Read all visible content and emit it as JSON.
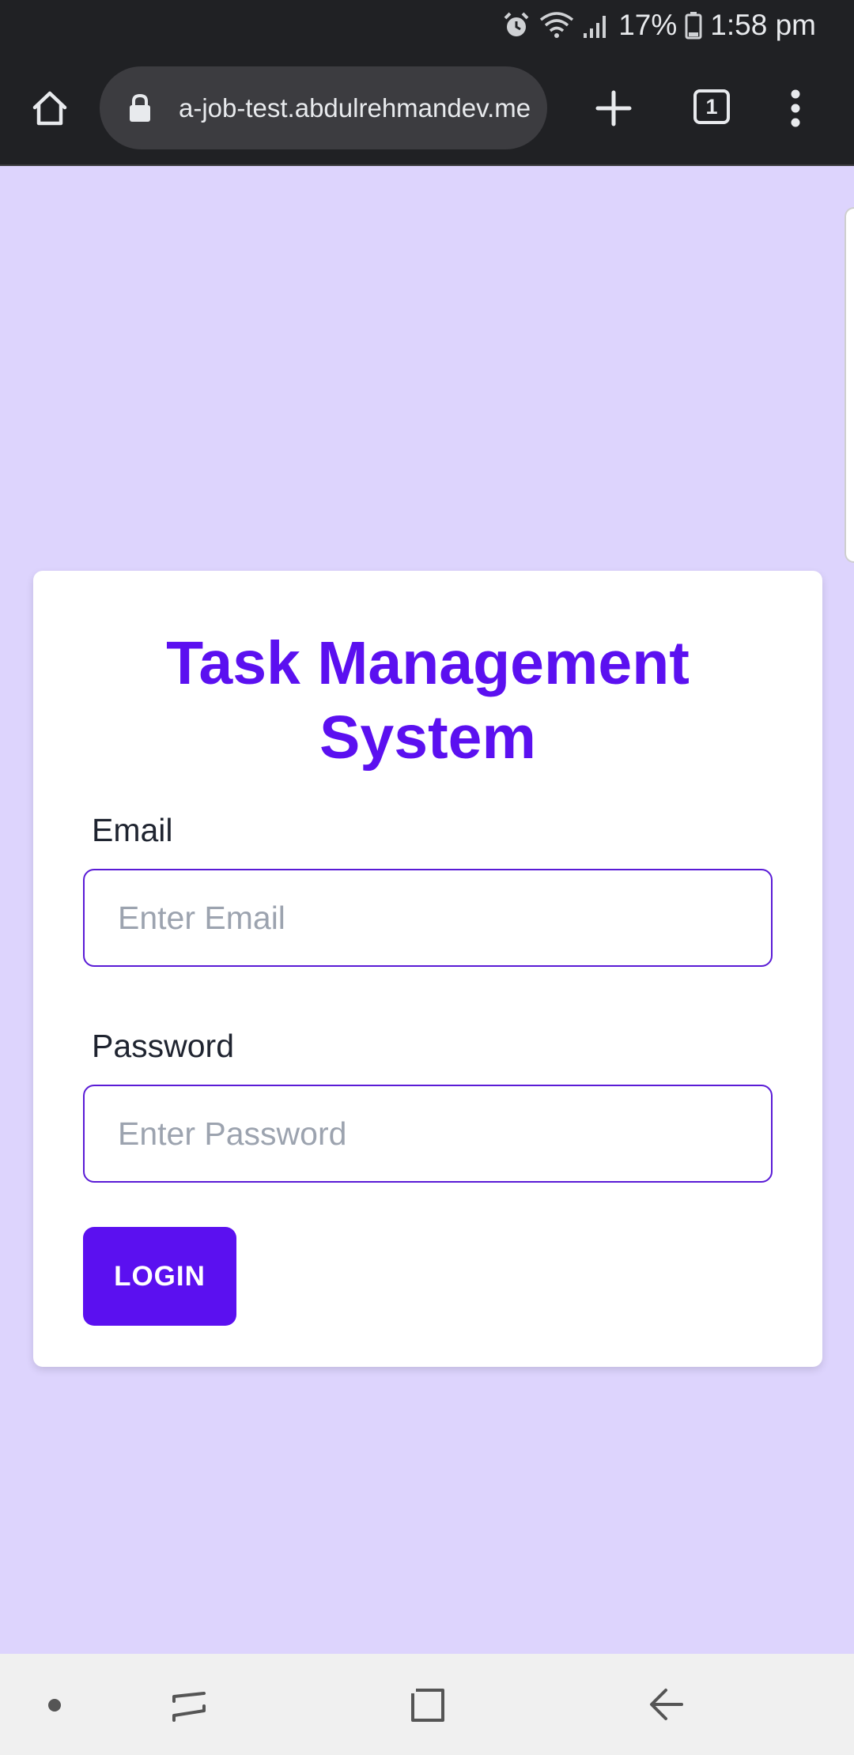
{
  "status_bar": {
    "battery": "17%",
    "time": "1:58 pm",
    "icons": [
      "alarm-icon",
      "wifi-icon",
      "signal-icon",
      "battery-icon"
    ]
  },
  "browser": {
    "url": "a-job-test.abdulrehmandev.me",
    "tab_count": "1",
    "icons": [
      "home-icon",
      "lock-icon",
      "new-tab-plus-icon",
      "overflow-menu-icon"
    ]
  },
  "login_card": {
    "title": "Task Management System",
    "email_label": "Email",
    "email_placeholder": "Enter Email",
    "email_value": "",
    "password_label": "Password",
    "password_placeholder": "Enter Password",
    "password_value": "",
    "login_button": "LOGIN"
  },
  "nav_bar": {
    "icons": [
      "dot-icon",
      "recents-icon",
      "home-square-icon",
      "back-arrow-icon"
    ]
  },
  "colors": {
    "page_background": "#ddd4fd",
    "accent": "#5b10f0",
    "browser_chrome": "#202124",
    "card_background": "#ffffff"
  }
}
